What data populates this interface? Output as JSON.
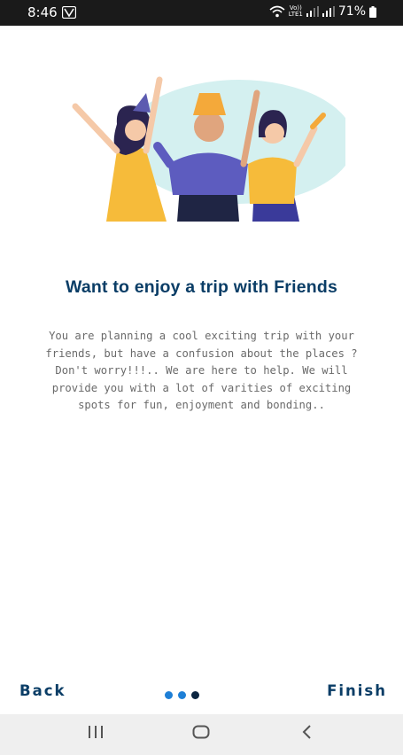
{
  "status_bar": {
    "time": "8:46",
    "signal_label_top": "Vo))",
    "signal_label_bottom": "LTE1",
    "battery": "71%"
  },
  "onboarding": {
    "title": "Want to enjoy a trip with Friends",
    "description": "You are planning a cool exciting trip with your friends, but have a confusion about the places ? Don't worry!!!.. We are here to help. We will provide you with a lot of varities of exciting spots for fun, enjoyment and bonding..",
    "illustration": "friends-party-illustration"
  },
  "footer": {
    "back_label": "Back",
    "finish_label": "Finish",
    "page_count": 3,
    "current_page": 3
  },
  "colors": {
    "title": "#0a3d66",
    "dot_inactive": "#1e7fd6",
    "dot_active": "#0b2540",
    "status_bar": "#1a1a1a",
    "nav_bar": "#efefef"
  },
  "system_nav": {
    "icons": [
      "recents-icon",
      "home-icon",
      "back-icon"
    ]
  }
}
